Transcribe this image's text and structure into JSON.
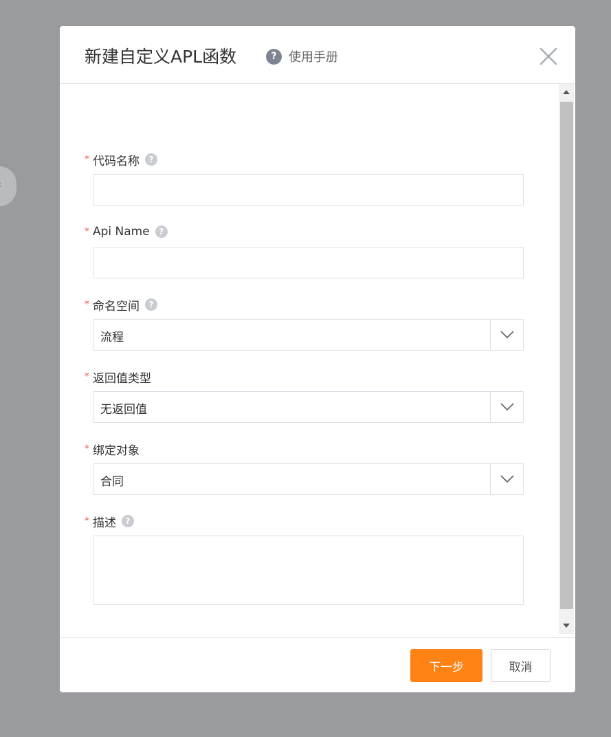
{
  "dialog": {
    "title": "新建自定义APL函数",
    "manual_link": "使用手册",
    "help_glyph": "?"
  },
  "form": {
    "required_mark": "*",
    "code_name": {
      "label": "代码名称",
      "value": "",
      "placeholder": ""
    },
    "api_name": {
      "label": "Api Name",
      "value": "",
      "placeholder": ""
    },
    "namespace": {
      "label": "命名空间",
      "value": "流程"
    },
    "return_type": {
      "label": "返回值类型",
      "value": "无返回值"
    },
    "bind_object": {
      "label": "绑定对象",
      "value": "合同"
    },
    "description": {
      "label": "描述",
      "value": "",
      "placeholder": ""
    }
  },
  "footer": {
    "next_label": "下一步",
    "cancel_label": "取消"
  },
  "icons": {
    "close": "close-icon",
    "help": "question-circle-icon",
    "dropdown": "chevron-down-icon"
  },
  "colors": {
    "primary": "#ff8314",
    "required": "#f0583e",
    "overlay": "#999b9f"
  }
}
